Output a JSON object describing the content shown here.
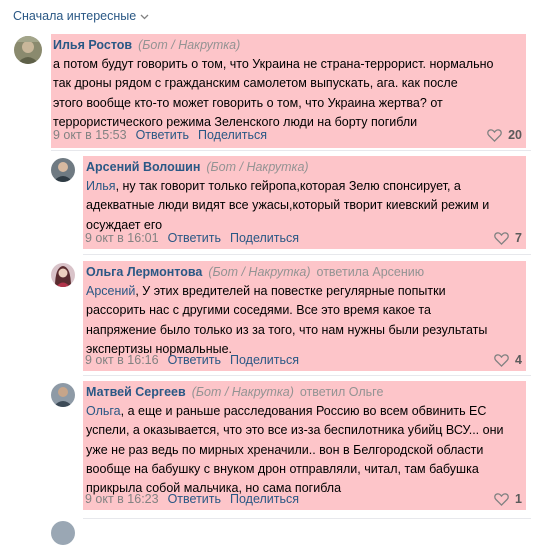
{
  "sort_label": "Сначала интересные",
  "comments": [
    {
      "author": "Илья Ростов",
      "tag": "(Бот / Накрутка)",
      "lines": [
        "а потом будут говорить о том, что Украина не страна-террорист. нормально",
        "так дроны рядом с гражданским самолетом выпускать, ага. как после",
        "этого вообще кто-то может говорить о том, что Украина жертва? от",
        "террористического режима Зеленского люди на борту погибли"
      ],
      "date": "9 окт в 15:53",
      "reply": "Ответить",
      "share": "Поделиться",
      "likes": "20"
    },
    {
      "author": "Арсений Волошин",
      "tag": "(Бот / Накрутка)",
      "mention": "Илья",
      "lines": [
        ", ну так говорит только гейропа,которая Зелю спонсирует, а",
        "адекватные люди видят все ужасы,который творит киевский режим и",
        "осуждает его"
      ],
      "date": "9 окт в 16:01",
      "reply": "Ответить",
      "share": "Поделиться",
      "likes": "7"
    },
    {
      "author": "Ольга Лермонтова",
      "tag": "(Бот / Накрутка)",
      "replied": "ответила Арсению",
      "mention": "Арсений",
      "lines": [
        ", У этих вредителей на повестке регулярные попытки",
        "рассорить нас с другими соседями. Все это время какое та",
        "напряжение было только из за того, что нам нужны были результаты",
        "экспертизы нормальные."
      ],
      "date": "9 окт в 16:16",
      "reply": "Ответить",
      "share": "Поделиться",
      "likes": "4"
    },
    {
      "author": "Матвей Сергеев",
      "tag": "(Бот / Накрутка)",
      "replied": "ответил Ольге",
      "mention": "Ольга",
      "lines": [
        ", а еще и раньше расследования Россию во всем обвинить ЕС",
        "успели, а оказывается, что это все из-за беспилотника убийц ВСУ... они",
        "уже не раз ведь по мирных хреначили.. вон в Белгородской области",
        "вообще на бабушку с внуком дрон отправляли, читал, там бабушка",
        "прикрыла собой мальчика, но сама погибла"
      ],
      "date": "9 окт в 16:23",
      "reply": "Ответить",
      "share": "Поделиться",
      "likes": "1"
    }
  ],
  "colors": {
    "highlight": "#fdc5c9",
    "link": "#2a5885",
    "muted": "#939393"
  }
}
